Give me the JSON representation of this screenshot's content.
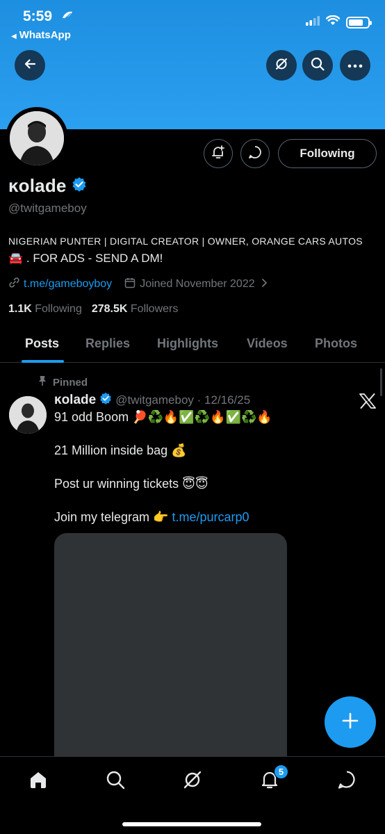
{
  "status_bar": {
    "time": "5:59",
    "back_app": "WhatsApp"
  },
  "header": {
    "back_icon": "arrow-left-icon",
    "grok_icon": "grok-icon",
    "search_icon": "search-icon",
    "more_icon": "more-horizontal-icon"
  },
  "profile": {
    "display_name": "ĸolade",
    "handle": "@twitgameboy",
    "bio_line1": "NIGERIAN PUNTER | DIGITAL CREATOR | OWNER, ORANGE CARS AUTOS",
    "bio_line2": "🚘 . FOR ADS - SEND A DM!",
    "link": "t.me/gameboyboy",
    "joined": "Joined November 2022",
    "following_count": "1.1K",
    "following_label": "Following",
    "followers_count": "278.5K",
    "followers_label": "Followers",
    "follow_button": "Following"
  },
  "tabs": [
    "Posts",
    "Replies",
    "Highlights",
    "Videos",
    "Photos"
  ],
  "post": {
    "pinned_label": "Pinned",
    "name": "ĸolade",
    "handle_date": "@twitgameboy · 12/16/25",
    "line1": "91 odd Boom 🏓♻️🔥✅♻️🔥✅♻️🔥",
    "line2": "21 Million inside bag 💰",
    "line3": "Post ur winning tickets 😇😇",
    "line4_prefix": "Join my telegram 👉 ",
    "line4_link": "t.me/purcarp0"
  },
  "nav": {
    "notification_badge": "5"
  },
  "colors": {
    "accent": "#1d9bf0",
    "banner": "#2b9ff0",
    "background": "#000000"
  }
}
